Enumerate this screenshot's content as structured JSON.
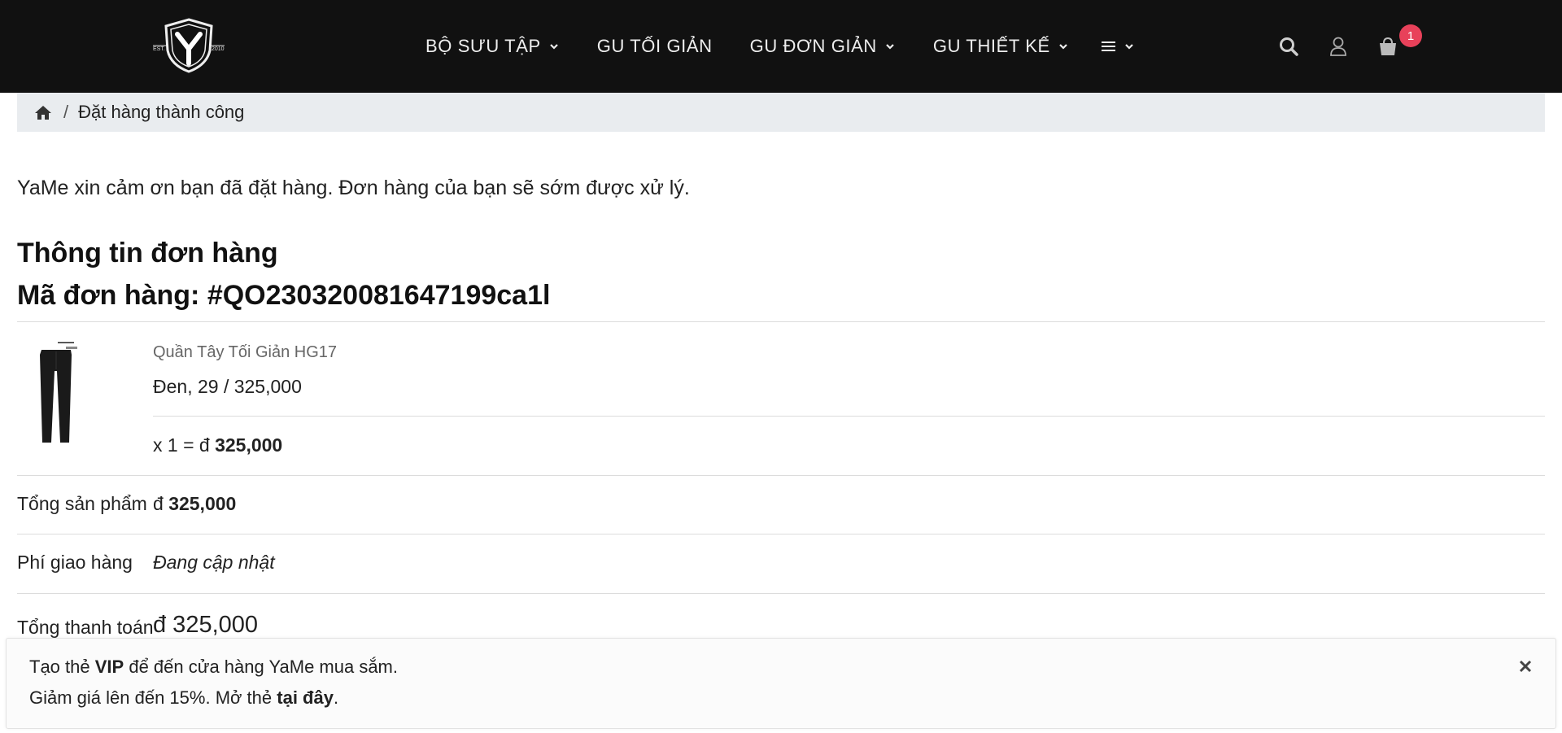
{
  "header": {
    "logo": {
      "est": "EST.",
      "year": "2010"
    },
    "nav": [
      {
        "label": "BỘ SƯU TẬP",
        "has_dropdown": true
      },
      {
        "label": "GU TỐI GIẢN",
        "has_dropdown": false
      },
      {
        "label": "GU ĐƠN GIẢN",
        "has_dropdown": true
      },
      {
        "label": "GU THIẾT KẾ",
        "has_dropdown": true
      }
    ],
    "more_menu_icon": "hamburger-icon",
    "icons": [
      "search-icon",
      "user-icon",
      "cart-icon"
    ],
    "cart_count": "1",
    "colors": {
      "bar": "#111111",
      "badge": "#e8415a"
    }
  },
  "breadcrumb": {
    "home_icon": "home-icon",
    "separator": "/",
    "current": "Đặt hàng thành công"
  },
  "main": {
    "thanks": "YaMe xin cảm ơn bạn đã đặt hàng. Đơn hàng của bạn sẽ sớm được xử lý.",
    "order_info_title": "Thông tin đơn hàng",
    "order_code_label": "Mã đơn hàng: #QO230320081647199ca1l",
    "item": {
      "name": "Quần Tây Tối Giản HG17",
      "variant": "Đen, 29 / 325,000",
      "qty_prefix": "x 1 = đ",
      "line_total": "325,000"
    },
    "subtotal": {
      "label": "Tổng sản phẩm",
      "currency": "đ",
      "value": "325,000"
    },
    "shipping": {
      "label": "Phí giao hàng",
      "value": "Đang cập nhật"
    },
    "total": {
      "label": "Tổng thanh toán",
      "value": "đ 325,000"
    }
  },
  "toast": {
    "line1_pre": "Tạo thẻ",
    "line1_bold": "VIP",
    "line1_post": "để đến cửa hàng YaMe mua sắm.",
    "line2_pre": "Giảm giá lên đến 15%. Mở thẻ",
    "line2_bold": "tại đây",
    "line2_post": ".",
    "close_icon": "close-icon"
  }
}
